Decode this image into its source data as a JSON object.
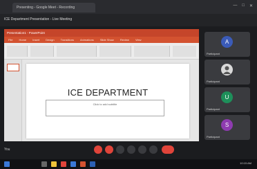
{
  "browser": {
    "tab_title": "Presenting - Google Meet - Recording",
    "controls": [
      "—",
      "□",
      "✕"
    ]
  },
  "meeting": {
    "title": "ICE Department Presentation - Live Meeting"
  },
  "powerpoint": {
    "window_title": "Presentation1 - PowerPoint",
    "ribbon_tabs": [
      "File",
      "Home",
      "Insert",
      "Design",
      "Transitions",
      "Animations",
      "Slide Show",
      "Review",
      "View"
    ]
  },
  "slide": {
    "title": "ICE DEPARTMENT",
    "subtitle": "Click to add subtitle"
  },
  "participants": [
    {
      "initial": "A",
      "name": "Participant",
      "color": "#3b5bb8"
    },
    {
      "initial": "",
      "name": "Participant",
      "color": "#d9d9d9"
    },
    {
      "initial": "U",
      "name": "Participant",
      "color": "#1e8f5a"
    },
    {
      "initial": "S",
      "name": "Participant",
      "color": "#8e3bb0"
    }
  ],
  "controls": {
    "self_label": "You",
    "buttons": [
      {
        "name": "mic",
        "color": "#e0443a"
      },
      {
        "name": "camera",
        "color": "#e0443a"
      },
      {
        "name": "captions",
        "color": "#3a3b3f"
      },
      {
        "name": "present",
        "color": "#3a3b3f"
      },
      {
        "name": "raise-hand",
        "color": "#3a3b3f"
      },
      {
        "name": "more",
        "color": "#3a3b3f"
      },
      {
        "name": "end-call",
        "color": "#e0443a"
      }
    ]
  },
  "taskbar": {
    "time": "10:15 AM"
  }
}
